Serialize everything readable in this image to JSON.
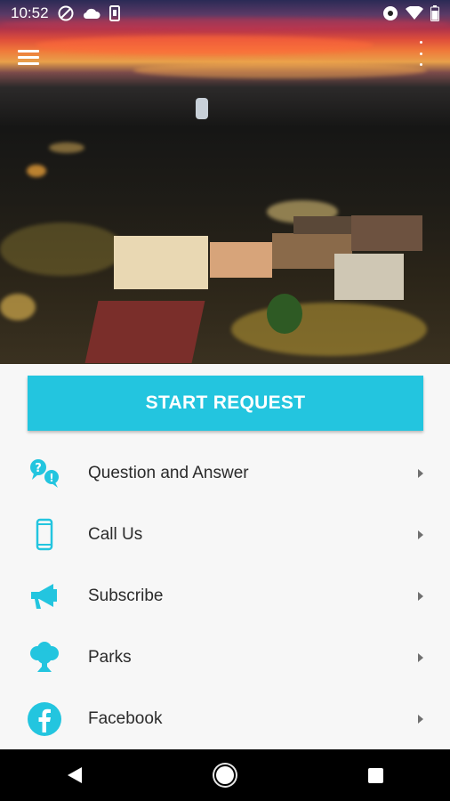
{
  "status_bar": {
    "time": "10:52",
    "left_icons": [
      "do-not-disturb-icon",
      "cloud-icon",
      "phone-status-icon"
    ],
    "right_icons": [
      "eye-icon",
      "wifi-icon",
      "battery-icon"
    ]
  },
  "header": {
    "menu_icon": "hamburger-menu-icon",
    "more_icon": "more-vertical-icon"
  },
  "main": {
    "start_request_label": "START REQUEST",
    "items": [
      {
        "label": "Question and Answer",
        "icon": "question-answer-icon"
      },
      {
        "label": "Call Us",
        "icon": "phone-icon"
      },
      {
        "label": "Subscribe",
        "icon": "megaphone-icon"
      },
      {
        "label": "Parks",
        "icon": "tree-icon"
      },
      {
        "label": "Facebook",
        "icon": "facebook-icon"
      }
    ]
  },
  "colors": {
    "accent": "#23c5df",
    "text": "#2b2b2b",
    "background": "#f7f7f7",
    "navbar": "#000000"
  }
}
